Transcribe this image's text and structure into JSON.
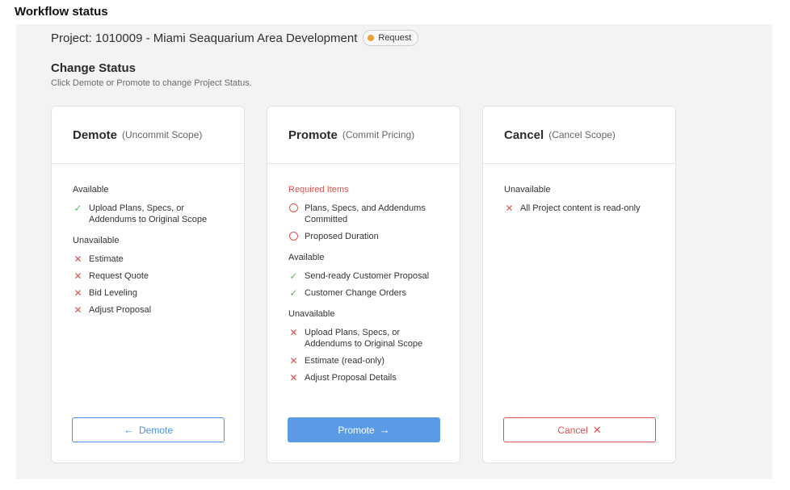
{
  "page_heading": "Workflow status",
  "project": {
    "title": "Project: 1010009 - Miami Seaquarium Area Development",
    "status_badge": "Request",
    "status_color": "#f0a030"
  },
  "change_status": {
    "title": "Change Status",
    "subtitle": "Click Demote or Promote to change Project Status."
  },
  "demote": {
    "title": "Demote",
    "hint": "(Uncommit Scope)",
    "available_label": "Available",
    "available": [
      "Upload Plans, Specs, or Addendums to Original Scope"
    ],
    "unavailable_label": "Unavailable",
    "unavailable": [
      "Estimate",
      "Request Quote",
      "Bid Leveling",
      "Adjust Proposal"
    ],
    "button_label": "Demote",
    "button_icon": "arrow-left-icon"
  },
  "promote": {
    "title": "Promote",
    "hint": "(Commit Pricing)",
    "required_label": "Required Items",
    "required": [
      "Plans, Specs, and Addendums Committed",
      "Proposed Duration"
    ],
    "available_label": "Available",
    "available": [
      "Send-ready Customer Proposal",
      "Customer Change Orders"
    ],
    "unavailable_label": "Unavailable",
    "unavailable": [
      "Upload Plans, Specs, or Addendums to Original Scope",
      "Estimate (read-only)",
      "Adjust Proposal Details"
    ],
    "button_label": "Promote",
    "button_icon": "arrow-right-icon"
  },
  "cancel": {
    "title": "Cancel",
    "hint": "(Cancel Scope)",
    "unavailable_label": "Unavailable",
    "unavailable": [
      "All Project content is read-only"
    ],
    "button_label": "Cancel",
    "button_icon": "x-icon"
  },
  "colors": {
    "accent": "#4a90e2",
    "danger": "#d9534f",
    "success": "#5cb85c"
  }
}
